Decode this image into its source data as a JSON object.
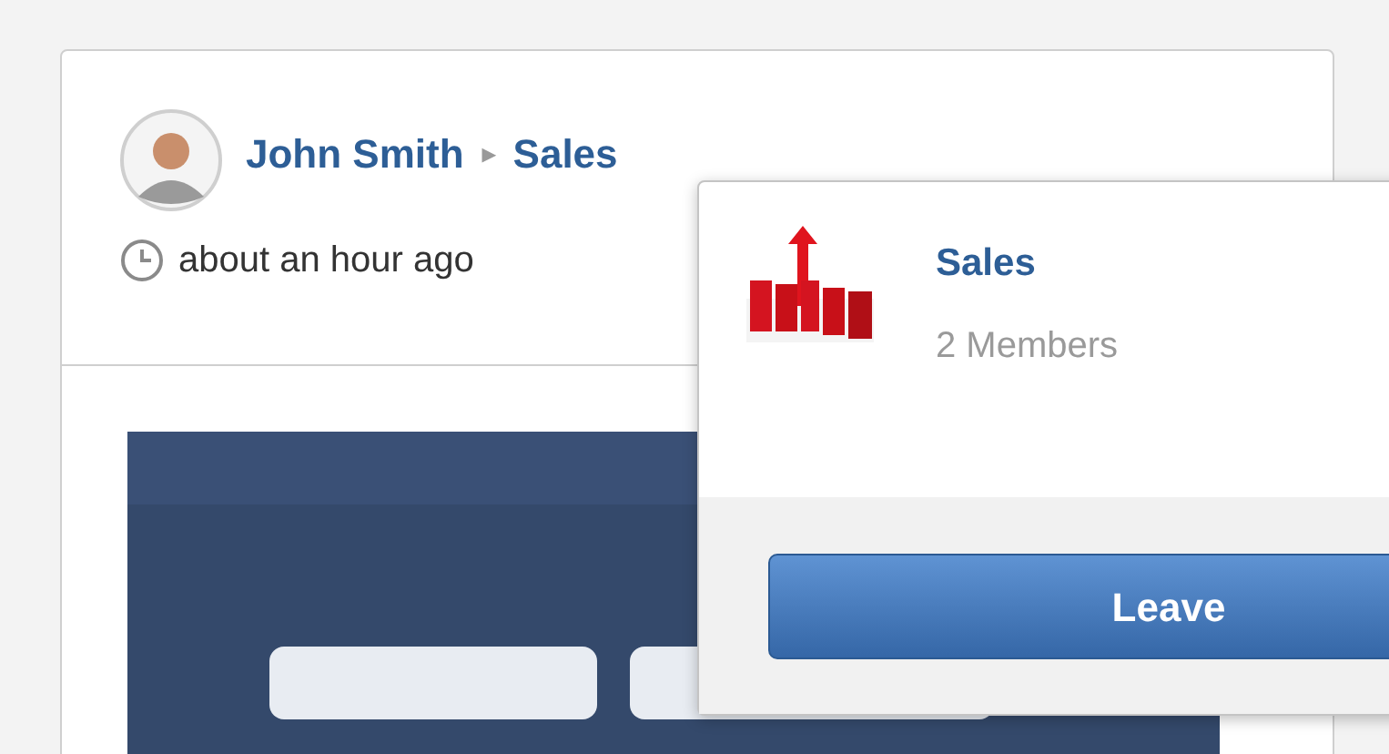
{
  "post": {
    "author": "John Smith",
    "separator": "▸",
    "group": "Sales",
    "time": "about an hour ago"
  },
  "popover": {
    "title": "Sales",
    "members": "2 Members",
    "button": "Leave"
  }
}
